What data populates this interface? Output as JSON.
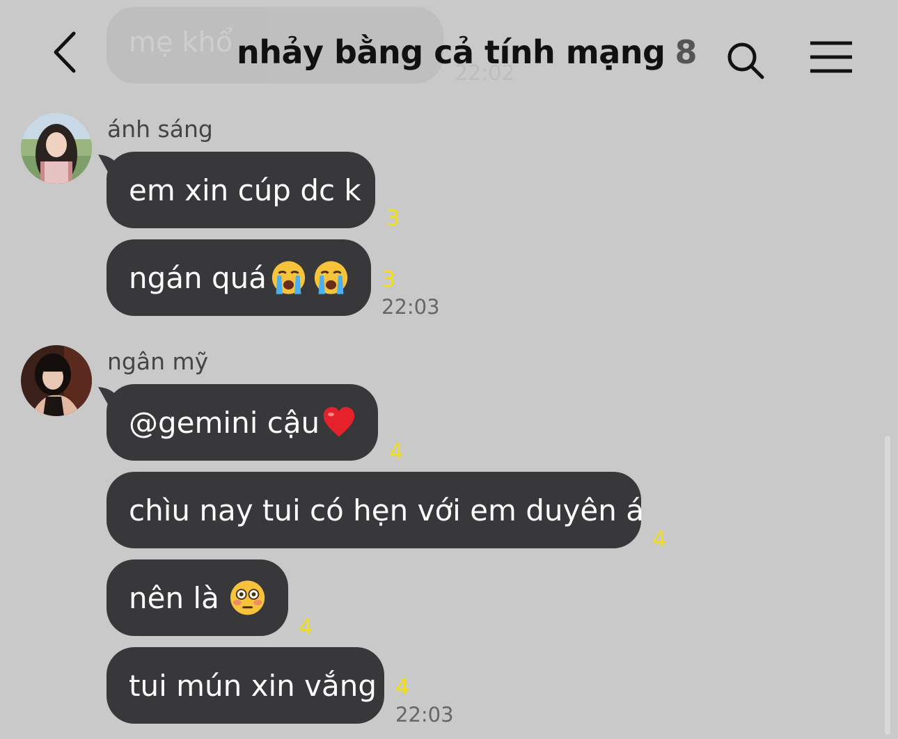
{
  "header": {
    "title": "nhảy bằng cả tính mạng",
    "member_count": "8",
    "back_icon": "chevron-left-icon",
    "search_icon": "search-icon",
    "menu_icon": "hamburger-menu-icon"
  },
  "ghost_message": {
    "text": "mẹ khổ lắm",
    "time": "22:02"
  },
  "groups": [
    {
      "sender": "ánh sáng",
      "messages": [
        {
          "text": "em xin cúp dc k",
          "read_count": "3"
        },
        {
          "text": "ngán quá",
          "emoji": [
            "loudly-crying-face",
            "loudly-crying-face"
          ],
          "read_count": "3",
          "time": "22:03"
        }
      ]
    },
    {
      "sender": "ngân mỹ",
      "messages": [
        {
          "text": "@gemini cậu",
          "emoji": [
            "red-heart"
          ],
          "read_count": "4"
        },
        {
          "text": "chìu nay tui có hẹn với em duyên á",
          "read_count": "4"
        },
        {
          "text": "nên là ",
          "emoji": [
            "flushed-face"
          ],
          "read_count": "4"
        },
        {
          "text": "tui mún xin vắng",
          "read_count": "4",
          "time": "22:03"
        }
      ]
    }
  ],
  "colors": {
    "background": "#c9c9c9",
    "bubble": "#38383b",
    "read_count": "#f2dd1b"
  }
}
